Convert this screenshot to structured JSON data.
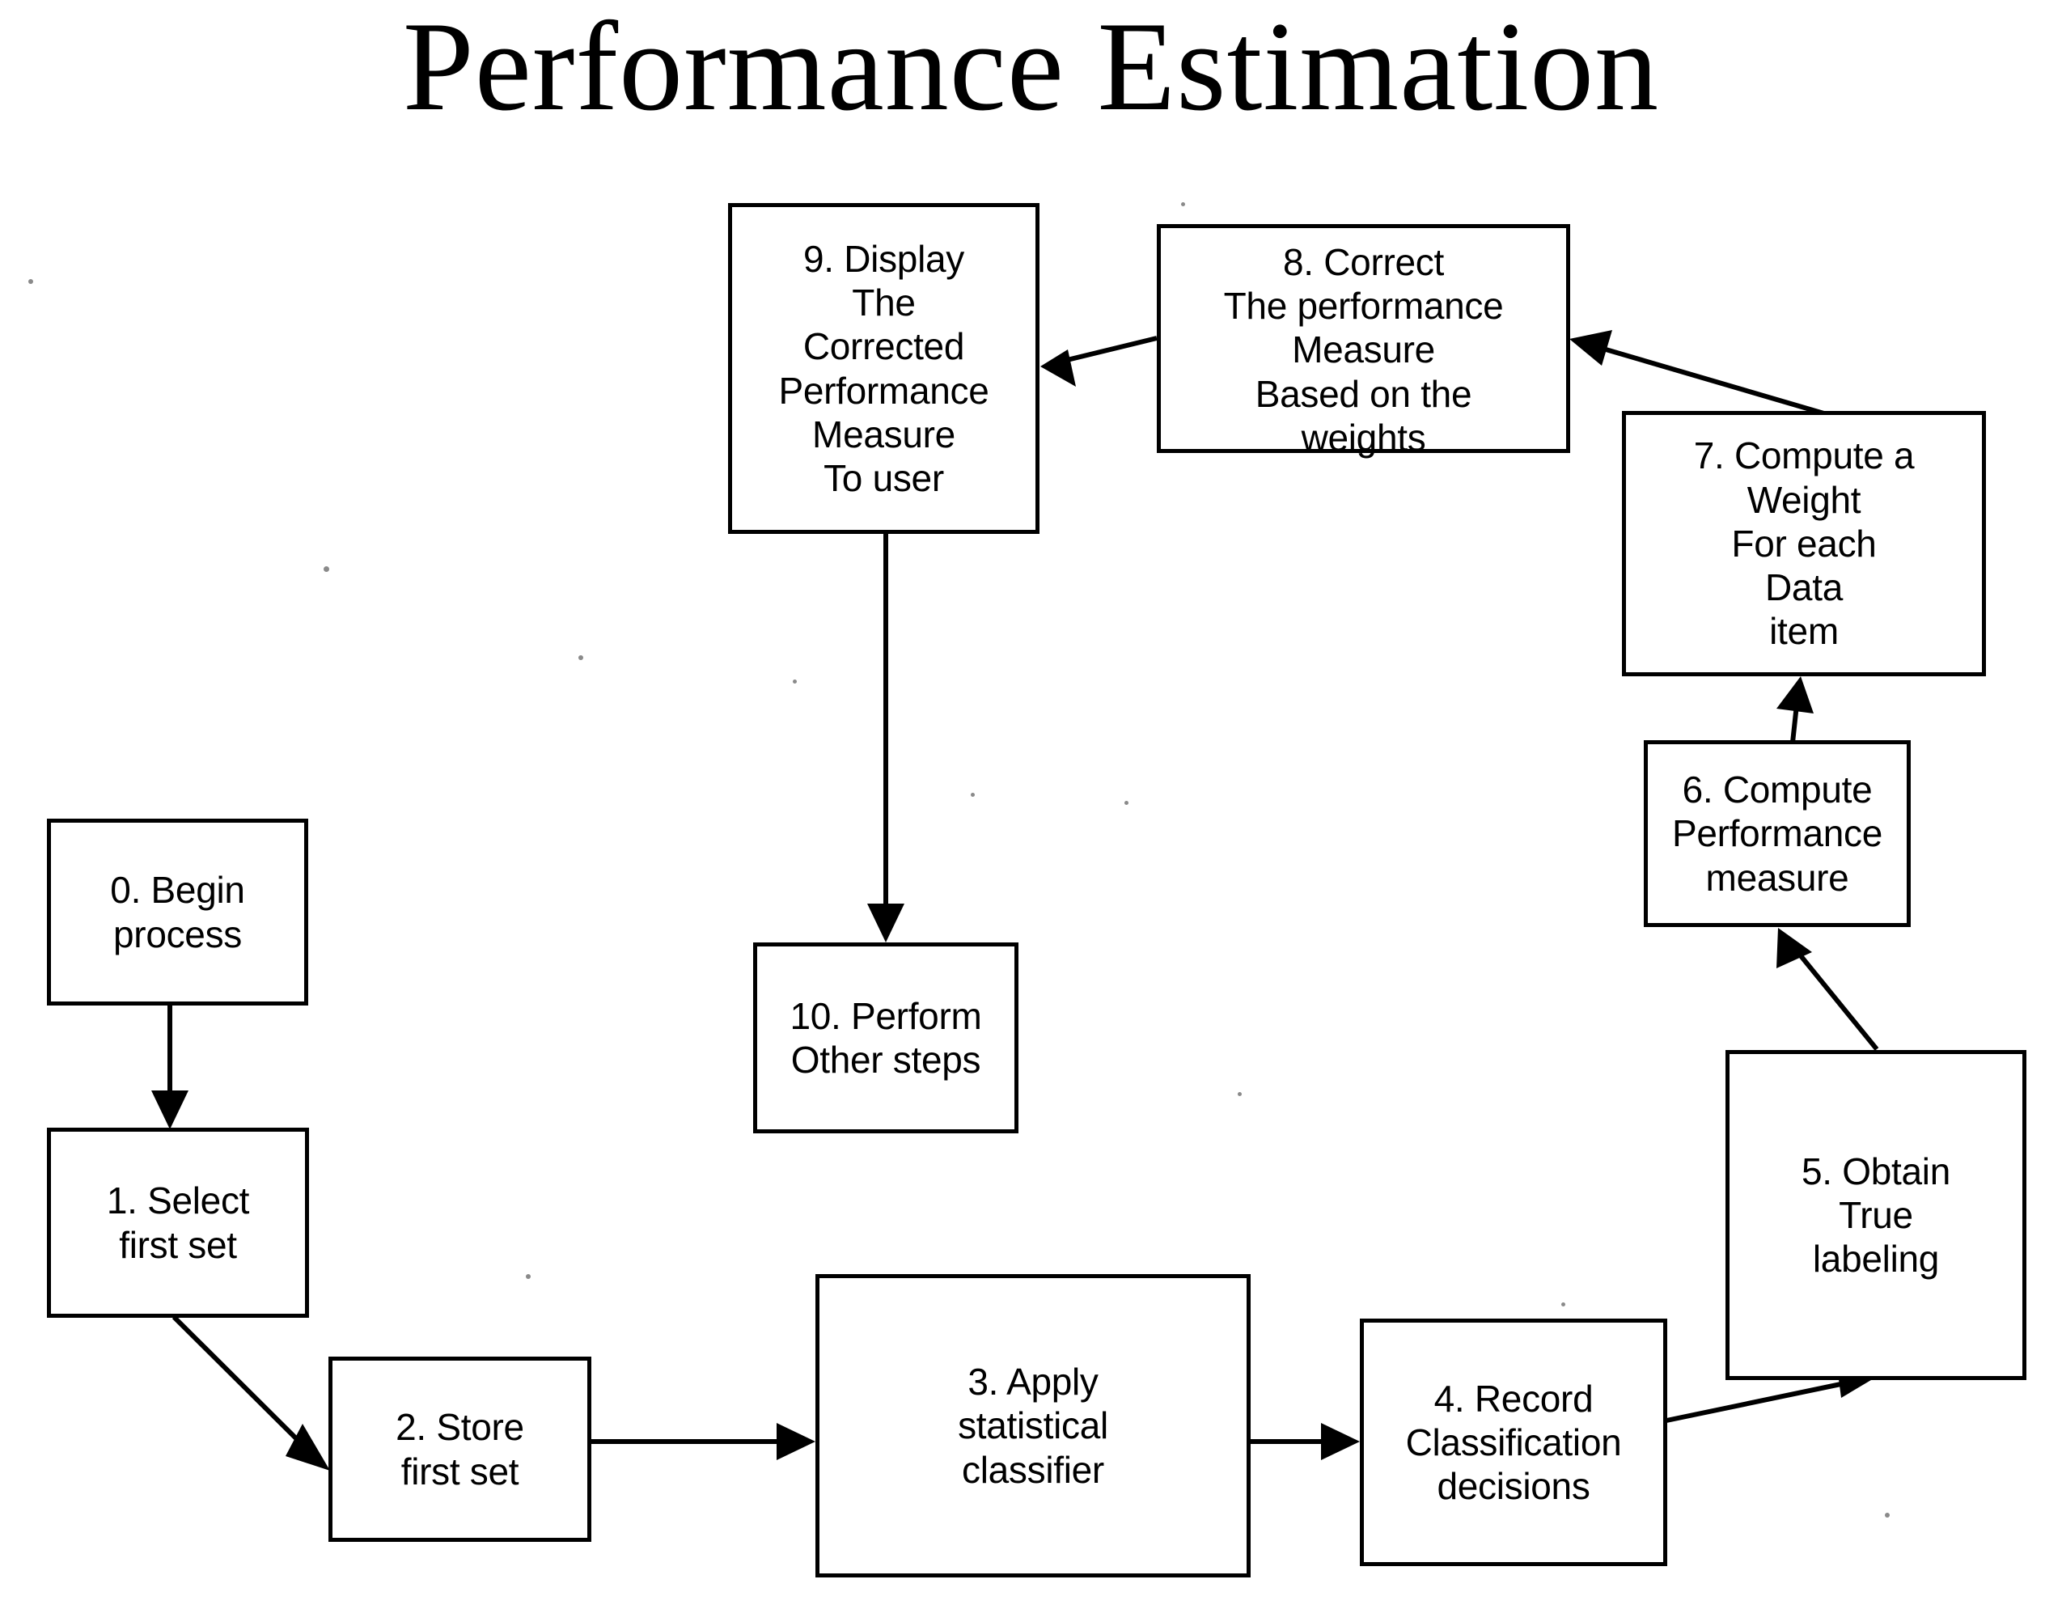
{
  "title": "Performance Estimation",
  "diagram": {
    "type": "flowchart",
    "orientation": "cycle-with-entry-and-exit",
    "nodes": [
      {
        "id": "n0",
        "number": "0",
        "text": "0. Begin\nprocess"
      },
      {
        "id": "n1",
        "number": "1",
        "text": "1. Select\nfirst set"
      },
      {
        "id": "n2",
        "number": "2",
        "text": "2. Store\nfirst set"
      },
      {
        "id": "n3",
        "number": "3",
        "text": "3. Apply\nstatistical\nclassifier"
      },
      {
        "id": "n4",
        "number": "4",
        "text": "4. Record\nClassification\ndecisions"
      },
      {
        "id": "n5",
        "number": "5",
        "text": "5. Obtain\nTrue\nlabeling"
      },
      {
        "id": "n6",
        "number": "6",
        "text": "6. Compute\nPerformance\nmeasure"
      },
      {
        "id": "n7",
        "number": "7",
        "text": "7. Compute a\nWeight\nFor each\nData\nitem"
      },
      {
        "id": "n8",
        "number": "8",
        "text": "8. Correct\nThe performance\nMeasure\nBased on the\nweights"
      },
      {
        "id": "n9",
        "number": "9",
        "text": "9. Display\nThe\nCorrected\nPerformance\nMeasure\nTo user"
      },
      {
        "id": "n10",
        "number": "10",
        "text": "10. Perform\nOther steps"
      }
    ],
    "edges": [
      {
        "from": "n0",
        "to": "n1",
        "style": "straight-vertical"
      },
      {
        "from": "n1",
        "to": "n2",
        "style": "diagonal"
      },
      {
        "from": "n2",
        "to": "n3",
        "style": "straight-horizontal"
      },
      {
        "from": "n3",
        "to": "n4",
        "style": "straight-horizontal"
      },
      {
        "from": "n4",
        "to": "n5",
        "style": "diagonal"
      },
      {
        "from": "n5",
        "to": "n6",
        "style": "diagonal"
      },
      {
        "from": "n6",
        "to": "n7",
        "style": "diagonal"
      },
      {
        "from": "n7",
        "to": "n8",
        "style": "diagonal"
      },
      {
        "from": "n8",
        "to": "n9",
        "style": "diagonal"
      },
      {
        "from": "n9",
        "to": "n10",
        "style": "straight-vertical"
      }
    ]
  },
  "colors": {
    "stroke": "#000000",
    "background": "#ffffff",
    "text": "#000000"
  }
}
